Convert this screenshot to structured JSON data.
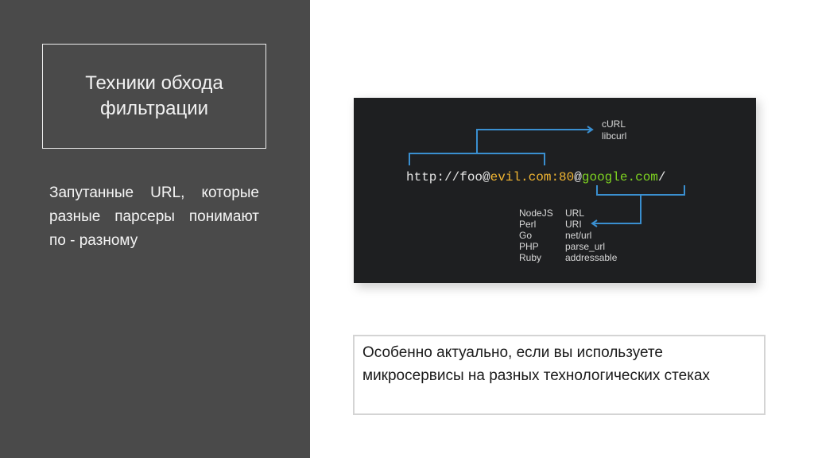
{
  "slide": {
    "title": "Техники обхода фильтрации",
    "left_text": "Запутанные URL, которые разные парсеры понимают по - разному",
    "note": "Особенно актуально, если вы используете микросервисы на разных технологических стеках"
  },
  "code_image": {
    "top_labels": [
      "cURL",
      "libcurl"
    ],
    "url_parts": {
      "scheme": "http://",
      "user": "foo",
      "at1": "@",
      "host1": "evil.com:80",
      "at2": "@",
      "host2": "google.com",
      "slash": "/"
    },
    "parsers": [
      {
        "lang": "NodeJS",
        "lib": "URL"
      },
      {
        "lang": "Perl",
        "lib": "URI"
      },
      {
        "lang": "Go",
        "lib": "net/url"
      },
      {
        "lang": "PHP",
        "lib": "parse_url"
      },
      {
        "lang": "Ruby",
        "lib": "addressable"
      }
    ],
    "colors": {
      "background": "#1e1f21",
      "text": "#e6e6e6",
      "evil_host": "#f2b632",
      "google_host": "#7ed321",
      "bracket": "#3a8fd0"
    }
  }
}
